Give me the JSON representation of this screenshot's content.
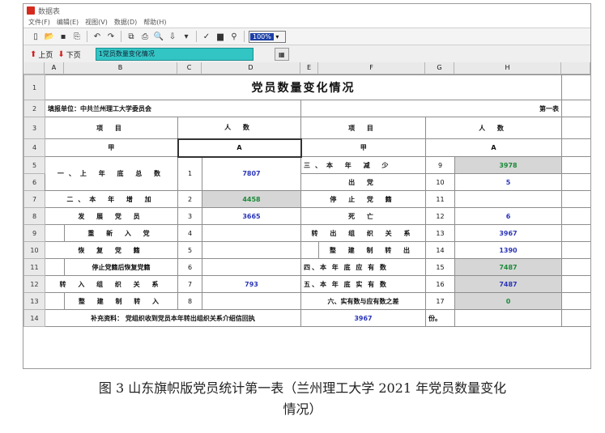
{
  "window": {
    "title": "数据表"
  },
  "menu": [
    "文件(F)",
    "编辑(E)",
    "视图(V)",
    "数据(D)",
    "帮助(H)"
  ],
  "toolbar": {
    "zoom": "100%"
  },
  "nav": {
    "prev": "上页",
    "next": "下页",
    "sheet_name": "1党员数量变化情况"
  },
  "columns": [
    "A",
    "B",
    "C",
    "D",
    "E",
    "F",
    "G",
    "H"
  ],
  "rows": {
    "r1": {
      "n": "1",
      "title": "党员数量变化情况"
    },
    "r2": {
      "n": "2",
      "unit": "填报单位：中共兰州理工大学委员会",
      "sheet_no": "第一表"
    },
    "r3": {
      "n": "3",
      "item1": "项 目",
      "count1": "人 数",
      "item2": "项 目",
      "count2": "人 数"
    },
    "r4": {
      "n": "4",
      "a1": "甲",
      "b1": "A",
      "a2": "甲",
      "b2": "A"
    },
    "r5": {
      "n": "5",
      "label_left": "一、上 年 底 总 数",
      "code_left": "1",
      "val_left": "7807",
      "label_right": "三、本 年 减 少",
      "code_right": "9",
      "val_right": "3978"
    },
    "r6": {
      "n": "6",
      "label_right": "出 党",
      "code_right": "10",
      "val_right": "5"
    },
    "r7": {
      "n": "7",
      "label_left": "二、本 年 增 加",
      "code_left": "2",
      "val_left": "4458",
      "label_right": "停 止 党 籍",
      "code_right": "11",
      "val_right": ""
    },
    "r8": {
      "n": "8",
      "label_left": "发 展 党 员",
      "code_left": "3",
      "val_left": "3665",
      "label_right": "死 亡",
      "code_right": "12",
      "val_right": "6"
    },
    "r9": {
      "n": "9",
      "label_left": "重 新 入 党",
      "code_left": "4",
      "val_left": "",
      "label_right": "转 出 组 织 关 系",
      "code_right": "13",
      "val_right": "3967"
    },
    "r10": {
      "n": "10",
      "label_left": "恢 复 党 籍",
      "code_left": "5",
      "val_left": "",
      "label_right": "整 建 制 转 出",
      "code_right": "14",
      "val_right": "1390"
    },
    "r11": {
      "n": "11",
      "label_left": "停止党籍后恢复党籍",
      "code_left": "6",
      "val_left": "",
      "label_right": "四、本 年 底 应 有 数",
      "code_right": "15",
      "val_right": "7487"
    },
    "r12": {
      "n": "12",
      "label_left": "转 入 组 织 关 系",
      "code_left": "7",
      "val_left": "793",
      "label_right": "五、本 年 底 实 有 数",
      "code_right": "16",
      "val_right": "7487"
    },
    "r13": {
      "n": "13",
      "label_left": "整 建 制 转 入",
      "code_left": "8",
      "val_left": "",
      "label_right": "六、实有数与应有数之差",
      "code_right": "17",
      "val_right": "0"
    },
    "r14": {
      "n": "14",
      "note": "补充资料：  党组织收到党员本年转出组织关系介绍信回执",
      "note_val": "3967",
      "note_unit": "份。"
    }
  },
  "caption_line1": "图 3  山东旗帜版党员统计第一表（兰州理工大学 2021 年党员数量变化",
  "caption_line2": "情况）"
}
